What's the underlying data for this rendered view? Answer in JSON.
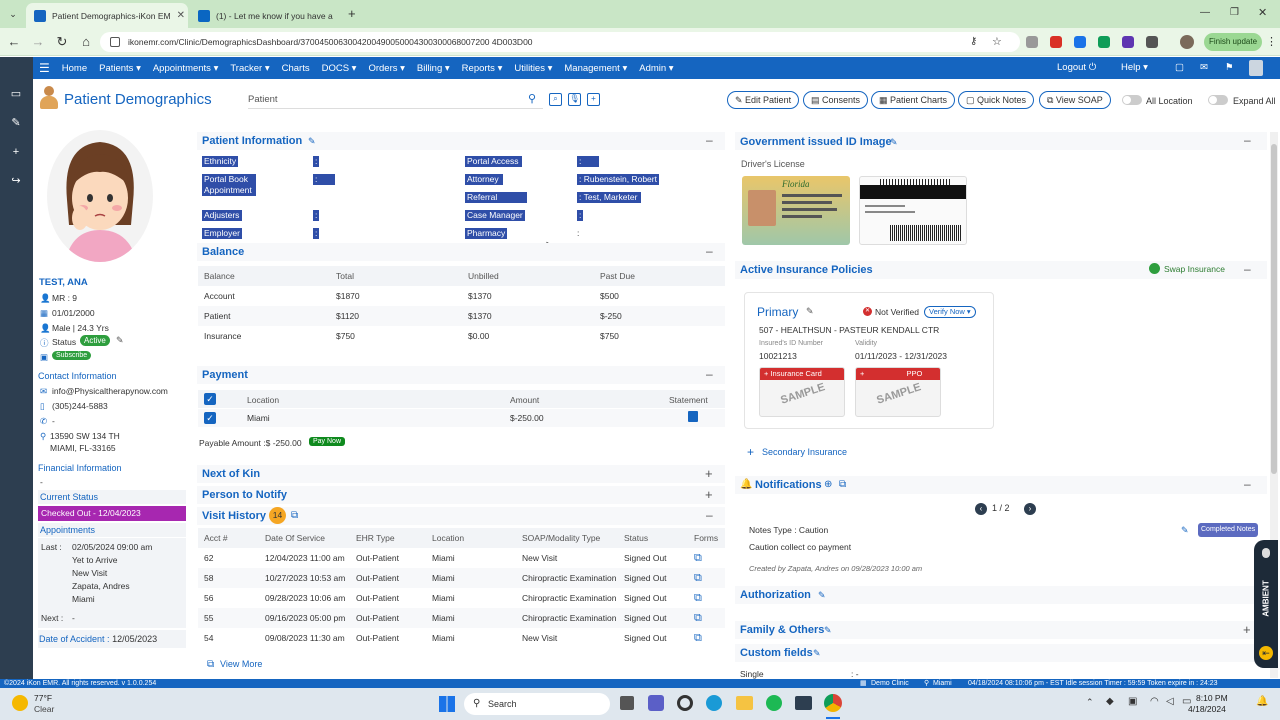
{
  "browser": {
    "tabs": [
      {
        "label": "Patient Demographics-iKon EM"
      },
      {
        "label": "(1) - Let me know if you have a"
      }
    ],
    "url": "ikonemr.com/Clinic/DemographicsDashboard/3700450063004200490050004300300068007200 4D003D00",
    "finish_update": "Finish update"
  },
  "nav": {
    "items": [
      "Home",
      "Patients ▾",
      "Appointments ▾",
      "Tracker ▾",
      "Charts",
      "DOCS ▾",
      "Orders ▾",
      "Billing ▾",
      "Reports ▾",
      "Utilities ▾",
      "Management ▾",
      "Admin ▾"
    ],
    "logout": "Logout ⏻",
    "help": "Help ▾"
  },
  "header": {
    "title": "Patient Demographics",
    "search_placeholder": "Patient",
    "buttons": [
      "✎ Edit Patient",
      "▤ Consents",
      "▦ Patient Charts",
      "▢ Quick Notes",
      "⧉ View SOAP"
    ],
    "toggle_all_location": "All Location",
    "toggle_expand_all": "Expand All"
  },
  "patient": {
    "name": "TEST, ANA",
    "mr": "MR : 9",
    "dob": "01/01/2000",
    "sex_age": "Male | 24.3 Yrs",
    "status_label": "Status",
    "status_value": "Active",
    "subscribe": "Subscribe",
    "contact_header": "Contact Information",
    "email": "info@Physicaltherapynow.com",
    "phone": "(305)244-5883",
    "phone2": "-",
    "address1": "13590 SW 134 TH",
    "address2": "MIAMI, FL-33165",
    "financial_header": "Financial Information",
    "financial_value": "-",
    "current_status_header": "Current Status",
    "current_status_value": "Checked Out - 12/04/2023",
    "appointments_header": "Appointments",
    "last_label": "Last :",
    "last_date": "02/05/2024 09:00 am",
    "last_status": "Yet to Arrive",
    "last_type": "New Visit",
    "last_provider": "Zapata, Andres",
    "last_location": "Miami",
    "next_label": "Next :",
    "next_value": "-",
    "accident_label": "Date of Accident :",
    "accident_value": "12/05/2023"
  },
  "info": {
    "title": "Patient Information",
    "left": [
      {
        "label": "Ethnicity",
        "value": ":"
      },
      {
        "label": "Portal Book Appointment",
        "value": ": Yes"
      },
      {
        "label": "Adjusters",
        "value": ":"
      },
      {
        "label": "Employer",
        "value": ":"
      }
    ],
    "right": [
      {
        "label": "Portal Access",
        "value": ": Yes"
      },
      {
        "label": "Attorney",
        "value": ": Rubenstein, Robert"
      },
      {
        "label": "Referral Source",
        "value": ": Test, Marketer"
      },
      {
        "label": "Case Manager",
        "value": ":"
      },
      {
        "label": "Pharmacy",
        "value": ":"
      }
    ]
  },
  "balance": {
    "title": "Balance",
    "headers": [
      "Balance",
      "Total",
      "Unbilled",
      "Past Due"
    ],
    "rows": [
      [
        "Account",
        "$1870",
        "$1370",
        "$500"
      ],
      [
        "Patient",
        "$1120",
        "$1370",
        "$-250"
      ],
      [
        "Insurance",
        "$750",
        "$0.00",
        "$750"
      ]
    ]
  },
  "payment": {
    "title": "Payment",
    "headers": [
      "Location",
      "Amount",
      "Statement"
    ],
    "row": [
      "Miami",
      "$-250.00"
    ],
    "payable": "Payable Amount :$ -250.00",
    "pay_now": "Pay Now"
  },
  "sections": {
    "kin": "Next of Kin",
    "notify": "Person to Notify",
    "visit": "Visit History",
    "visit_count": "14",
    "view_more": "View More"
  },
  "visits": {
    "headers": [
      "Acct #",
      "Date Of Service",
      "EHR Type",
      "Location",
      "SOAP/Modality Type",
      "Status",
      "Forms"
    ],
    "rows": [
      [
        "62",
        "12/04/2023 11:00 am",
        "Out-Patient",
        "Miami",
        "New Visit",
        "Signed Out"
      ],
      [
        "58",
        "10/27/2023 10:53 am",
        "Out-Patient",
        "Miami",
        "Chiropractic Examination",
        "Signed Out"
      ],
      [
        "56",
        "09/28/2023 10:06 am",
        "Out-Patient",
        "Miami",
        "Chiropractic Examination",
        "Signed Out"
      ],
      [
        "55",
        "09/16/2023 05:00 pm",
        "Out-Patient",
        "Miami",
        "Chiropractic Examination",
        "Signed Out"
      ],
      [
        "54",
        "09/08/2023 11:30 am",
        "Out-Patient",
        "Miami",
        "New Visit",
        "Signed Out"
      ]
    ]
  },
  "right": {
    "gov_id_title": "Government issued ID Image",
    "drivers_license": "Driver's License",
    "license_state": "Florida",
    "insurance_title": "Active Insurance Policies",
    "swap": "Swap Insurance",
    "primary": "Primary",
    "not_verified": "Not Verified",
    "verify_now": "Verify Now ▾",
    "plan": "507 - HEALTHSUN - PASTEUR KENDALL CTR",
    "id_label": "Insured's ID Number",
    "id_value": "10021213",
    "validity_label": "Validity",
    "validity_value": "01/11/2023 - 12/31/2023",
    "card1": "Insurance Card",
    "card2": "PPO",
    "sample": "SAMPLE",
    "secondary": "Secondary Insurance",
    "notifications_title": "Notifications",
    "pager": "1 / 2",
    "note_type": "Notes Type : Caution",
    "note_text": "Caution collect co payment",
    "completed": "Completed Notes",
    "note_created": "Created by Zapata, Andres on 09/28/2023 10:00 am",
    "authorization": "Authorization",
    "family": "Family & Others",
    "custom": "Custom fields",
    "single": "Single",
    "single_val": ": -"
  },
  "statusbar": {
    "left": "©2024 iKon EMR. All rights reserved. v 1.0.0.254",
    "clinic": "Demo Clinic",
    "loc": "Miami",
    "right": "04/18/2024 08:10:06 pm - EST   Idle session Timer : 59:59  Token expire in : 24:23"
  },
  "taskbar": {
    "temp": "77°F",
    "weather": "Clear",
    "search": "Search",
    "time": "8:10 PM",
    "date": "4/18/2024"
  },
  "ambient": "AMBIENT"
}
